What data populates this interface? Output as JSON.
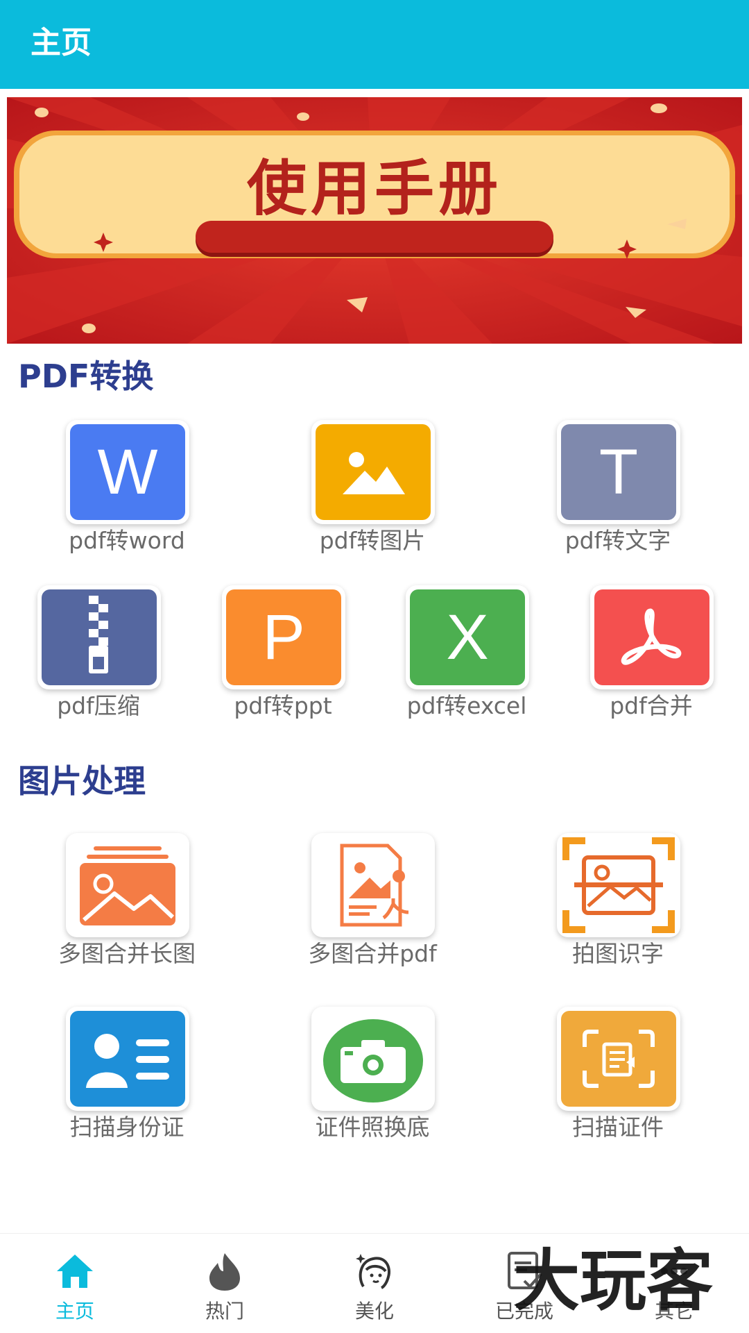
{
  "header": {
    "title": "主页"
  },
  "banner": {
    "title": "使用手册"
  },
  "sections": [
    {
      "title": "PDF转换",
      "items": [
        {
          "label": "pdf转word",
          "icon": "word-icon",
          "color": "#4a7bf2"
        },
        {
          "label": "pdf转图片",
          "icon": "image-icon",
          "color": "#f4ab00"
        },
        {
          "label": "pdf转文字",
          "icon": "text-icon",
          "color": "#7f89ad"
        },
        {
          "label": "pdf压缩",
          "icon": "zip-icon",
          "color": "#5567a0"
        },
        {
          "label": "pdf转ppt",
          "icon": "ppt-icon",
          "color": "#fa8c2e"
        },
        {
          "label": "pdf转excel",
          "icon": "excel-icon",
          "color": "#4caf50"
        },
        {
          "label": "pdf合并",
          "icon": "acrobat-icon",
          "color": "#f4504f"
        }
      ]
    },
    {
      "title": "图片处理",
      "items": [
        {
          "label": "多图合并长图",
          "icon": "stacked-images-icon",
          "color": "#f47c45"
        },
        {
          "label": "多图合并pdf",
          "icon": "image-to-pdf-icon",
          "color": "#f47c45"
        },
        {
          "label": "拍图识字",
          "icon": "scan-image-icon",
          "color": "#e66a2c"
        },
        {
          "label": "扫描身份证",
          "icon": "id-card-icon",
          "color": "#1e8fd8"
        },
        {
          "label": "证件照换底",
          "icon": "camera-icon",
          "color": "#4caf50"
        },
        {
          "label": "扫描证件",
          "icon": "scan-document-icon",
          "color": "#f0a93b"
        }
      ]
    }
  ],
  "letters": {
    "word": "W",
    "text": "T",
    "ppt": "P",
    "excel": "X"
  },
  "bottom_nav": [
    {
      "label": "主页",
      "icon": "home-icon",
      "active": true
    },
    {
      "label": "热门",
      "icon": "flame-icon",
      "active": false
    },
    {
      "label": "美化",
      "icon": "beauty-face-icon",
      "active": false
    },
    {
      "label": "已完成",
      "icon": "completed-doc-icon",
      "active": false
    },
    {
      "label": "其它",
      "icon": "more-icon",
      "active": false
    }
  ],
  "watermark": "大玩客",
  "colors": {
    "accent": "#0bbbdc",
    "section_title": "#2d3e8f",
    "banner_red": "#c9201e",
    "banner_panel": "#fddc95"
  }
}
